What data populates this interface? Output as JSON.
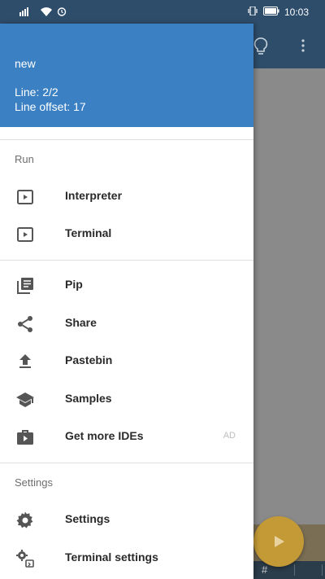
{
  "status_bar": {
    "left_indicators": "⁴⁶",
    "time": "10:03"
  },
  "drawer": {
    "header": {
      "file_name": "new",
      "line": "Line: 2/2",
      "line_offset": "Line offset: 17"
    },
    "sections": [
      {
        "title": "Run",
        "items": [
          {
            "label": "Interpreter",
            "icon": "play-box-icon"
          },
          {
            "label": "Terminal",
            "icon": "play-box-icon"
          }
        ]
      },
      {
        "title": "",
        "items": [
          {
            "label": "Pip",
            "icon": "library-icon"
          },
          {
            "label": "Share",
            "icon": "share-icon"
          },
          {
            "label": "Pastebin",
            "icon": "upload-icon"
          },
          {
            "label": "Samples",
            "icon": "school-icon"
          },
          {
            "label": "Get more IDEs",
            "icon": "store-icon",
            "badge": "AD"
          }
        ]
      },
      {
        "title": "Settings",
        "items": [
          {
            "label": "Settings",
            "icon": "gear-icon"
          },
          {
            "label": "Terminal settings",
            "icon": "terminal-settings-icon"
          }
        ]
      }
    ]
  },
  "background_app": {
    "bottom_bar_symbol": "#"
  },
  "colors": {
    "status_bar": "#2e4d6b",
    "drawer_header": "#3b80c2",
    "fab": "#c39a36"
  }
}
